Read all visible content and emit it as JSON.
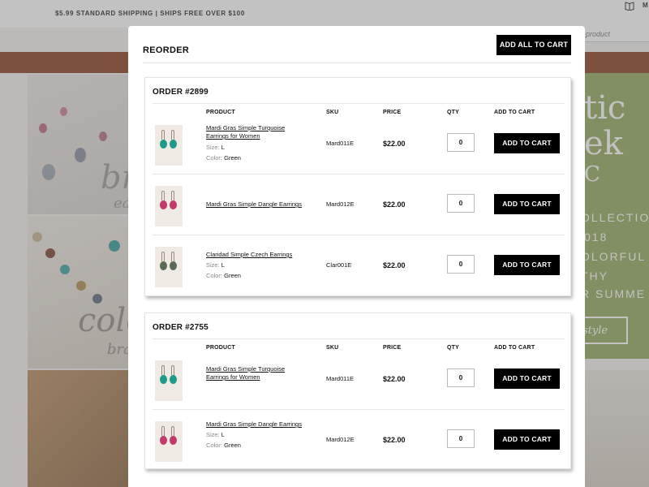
{
  "store": {
    "shipping_banner": "$5.99 STANDARD SHIPPING | SHIPS FREE OVER $100",
    "account_letter": "M",
    "search_placeholder": "product",
    "promo_text_1": "bra",
    "promo_text_1b": "ea",
    "promo_text_2": "colo",
    "promo_text_2b": "bra",
    "promo_right": {
      "line1": "tic",
      "line2": "ek",
      "line3": "C",
      "line4": "OLLECTIO",
      "line5": "018",
      "line6": "OLORFUL",
      "line7": "THY",
      "line8": "R SUMME",
      "button": "style"
    }
  },
  "modal": {
    "title": "REORDER",
    "add_all_label": "ADD ALL TO CART",
    "columns": {
      "product": "PRODUCT",
      "sku": "SKU",
      "price": "PRICE",
      "qty": "QTY",
      "add_to_cart": "ADD TO CART"
    },
    "size_label": "Size:",
    "color_label": "Color:",
    "orders": [
      {
        "title": "ORDER #2899",
        "items": [
          {
            "name": "Mardi Gras Simple Turquoise Earrings for Women",
            "size": "L",
            "color": "Green",
            "sku": "Mard011E",
            "price": "$22.00",
            "qty": "0",
            "button": "ADD TO CART",
            "stone_color": "#1f9a8a"
          },
          {
            "name": "Mardi Gras Simple Dangle Earrings",
            "size": "",
            "color": "",
            "sku": "Mard012E",
            "price": "$22.00",
            "qty": "0",
            "button": "ADD TO CART",
            "stone_color": "#c23a6a"
          },
          {
            "name": "Claridad Simple Czech Earrings",
            "size": "L",
            "color": "Green",
            "sku": "Clar001E",
            "price": "$22.00",
            "qty": "0",
            "button": "ADD TO CART",
            "stone_color": "#5a6a55"
          }
        ]
      },
      {
        "title": "ORDER #2755",
        "items": [
          {
            "name": "Mardi Gras Simple Turquoise Earrings for Women",
            "size": "",
            "color": "",
            "sku": "Mard011E",
            "price": "$22.00",
            "qty": "0",
            "button": "ADD TO CART",
            "stone_color": "#1f9a8a"
          },
          {
            "name": "Mardi Gras Simple Dangle Earrings",
            "size": "L",
            "color": "Green",
            "sku": "Mard012E",
            "price": "$22.00",
            "qty": "0",
            "button": "ADD TO CART",
            "stone_color": "#c23a6a"
          }
        ]
      }
    ]
  }
}
